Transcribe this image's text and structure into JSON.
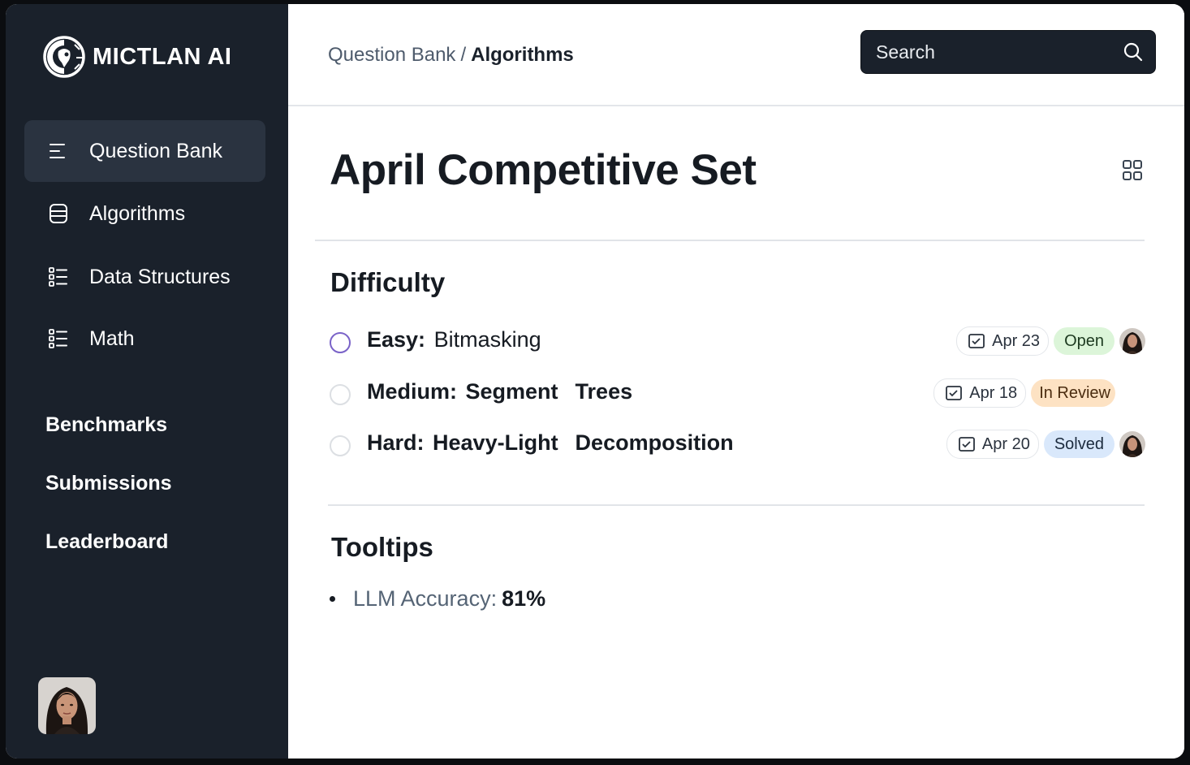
{
  "app": {
    "name": "MICTLAN AI"
  },
  "sidebar": {
    "items": [
      {
        "label": "Question Bank",
        "icon": "list-icon",
        "active": true
      },
      {
        "label": "Algorithms",
        "icon": "database-icon",
        "active": false
      },
      {
        "label": "Data Structures",
        "icon": "bulleted-list-icon",
        "active": false
      },
      {
        "label": "Math",
        "icon": "bulleted-list-icon",
        "active": false
      }
    ],
    "links": [
      {
        "label": "Benchmarks"
      },
      {
        "label": "Submissions"
      },
      {
        "label": "Leaderboard"
      }
    ]
  },
  "header": {
    "breadcrumb": {
      "parent": "Question Bank",
      "separator": "/",
      "current": "Algorithms"
    },
    "search": {
      "placeholder": "Search"
    }
  },
  "page": {
    "title": "April Competitive Set"
  },
  "difficulty": {
    "title": "Difficulty",
    "tasks": [
      {
        "level": "Easy:",
        "topic": "Bitmasking",
        "date": "Apr 23",
        "status": "Open",
        "status_color": "#dcf5d9",
        "has_avatar": true
      },
      {
        "level": "Medium:",
        "topic": "Segment  Trees",
        "date": "Apr 18",
        "status": "In Review",
        "status_color": "#fde2c3",
        "has_avatar": false
      },
      {
        "level": "Hard:",
        "topic": "Heavy-Light  Decomposition",
        "date": "Apr 20",
        "status": "Solved",
        "status_color": "#d9e8fb",
        "has_avatar": true
      }
    ]
  },
  "tooltips": {
    "title": "Tooltips",
    "items": [
      {
        "key": "LLM Accuracy:",
        "value": "81%"
      }
    ]
  },
  "colors": {
    "sidebar_bg": "#1a212b",
    "accent": "#7a63c8"
  }
}
